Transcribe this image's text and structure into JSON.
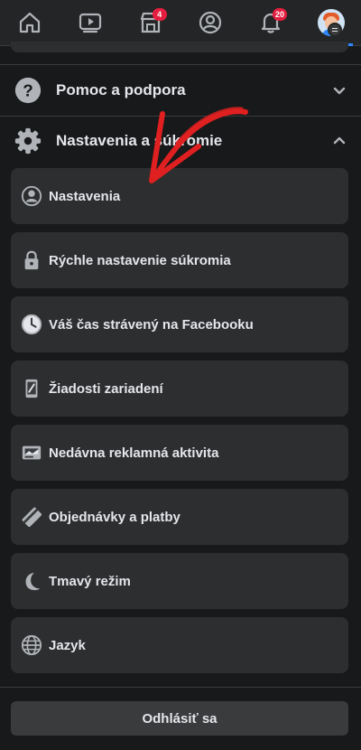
{
  "topnav": {
    "items": [
      {
        "icon": "home-icon"
      },
      {
        "icon": "watch-video-icon"
      },
      {
        "icon": "marketplace-icon",
        "badge": "4"
      },
      {
        "icon": "profile-icon"
      },
      {
        "icon": "notifications-bell-icon",
        "badge": "20"
      },
      {
        "icon": "menu-avatar-icon",
        "active": true
      }
    ]
  },
  "sections": {
    "help": {
      "label": "Pomoc a podpora",
      "icon": "help-question-icon"
    },
    "settings": {
      "label": "Nastavenia a súkromie",
      "icon": "settings-gear-icon"
    }
  },
  "menu": {
    "items": [
      {
        "label": "Nastavenia",
        "icon": "user-circle-icon"
      },
      {
        "label": "Rýchle nastavenie súkromia",
        "icon": "lock-icon"
      },
      {
        "label": "Váš čas strávený na Facebooku",
        "icon": "clock-icon"
      },
      {
        "label": "Žiadosti zariadení",
        "icon": "device-icon"
      },
      {
        "label": "Nedávna reklamná aktivita",
        "icon": "ad-activity-icon"
      },
      {
        "label": "Objednávky a platby",
        "icon": "payment-card-icon"
      },
      {
        "label": "Tmavý režim",
        "icon": "moon-icon"
      },
      {
        "label": "Jazyk",
        "icon": "globe-icon"
      }
    ]
  },
  "logout_label": "Odhlásiť sa",
  "colors": {
    "background": "#18191a",
    "card": "#2d2e2f",
    "badge": "#e41e3f",
    "active_tab": "#2d88ff",
    "annotation_arrow": "#e02020"
  }
}
